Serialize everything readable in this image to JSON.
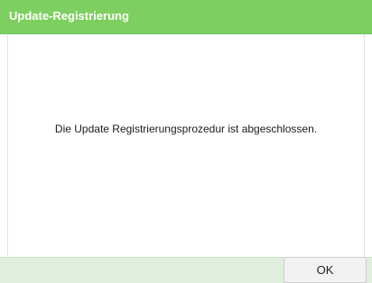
{
  "dialog": {
    "title": "Update-Registrierung",
    "message": "Die Update Registrierungsprozedur ist abgeschlossen.",
    "ok_label": "OK"
  },
  "colors": {
    "title_bar": "#7dcf5f",
    "footer": "#dfeedd",
    "button": "#f2f2f2"
  }
}
